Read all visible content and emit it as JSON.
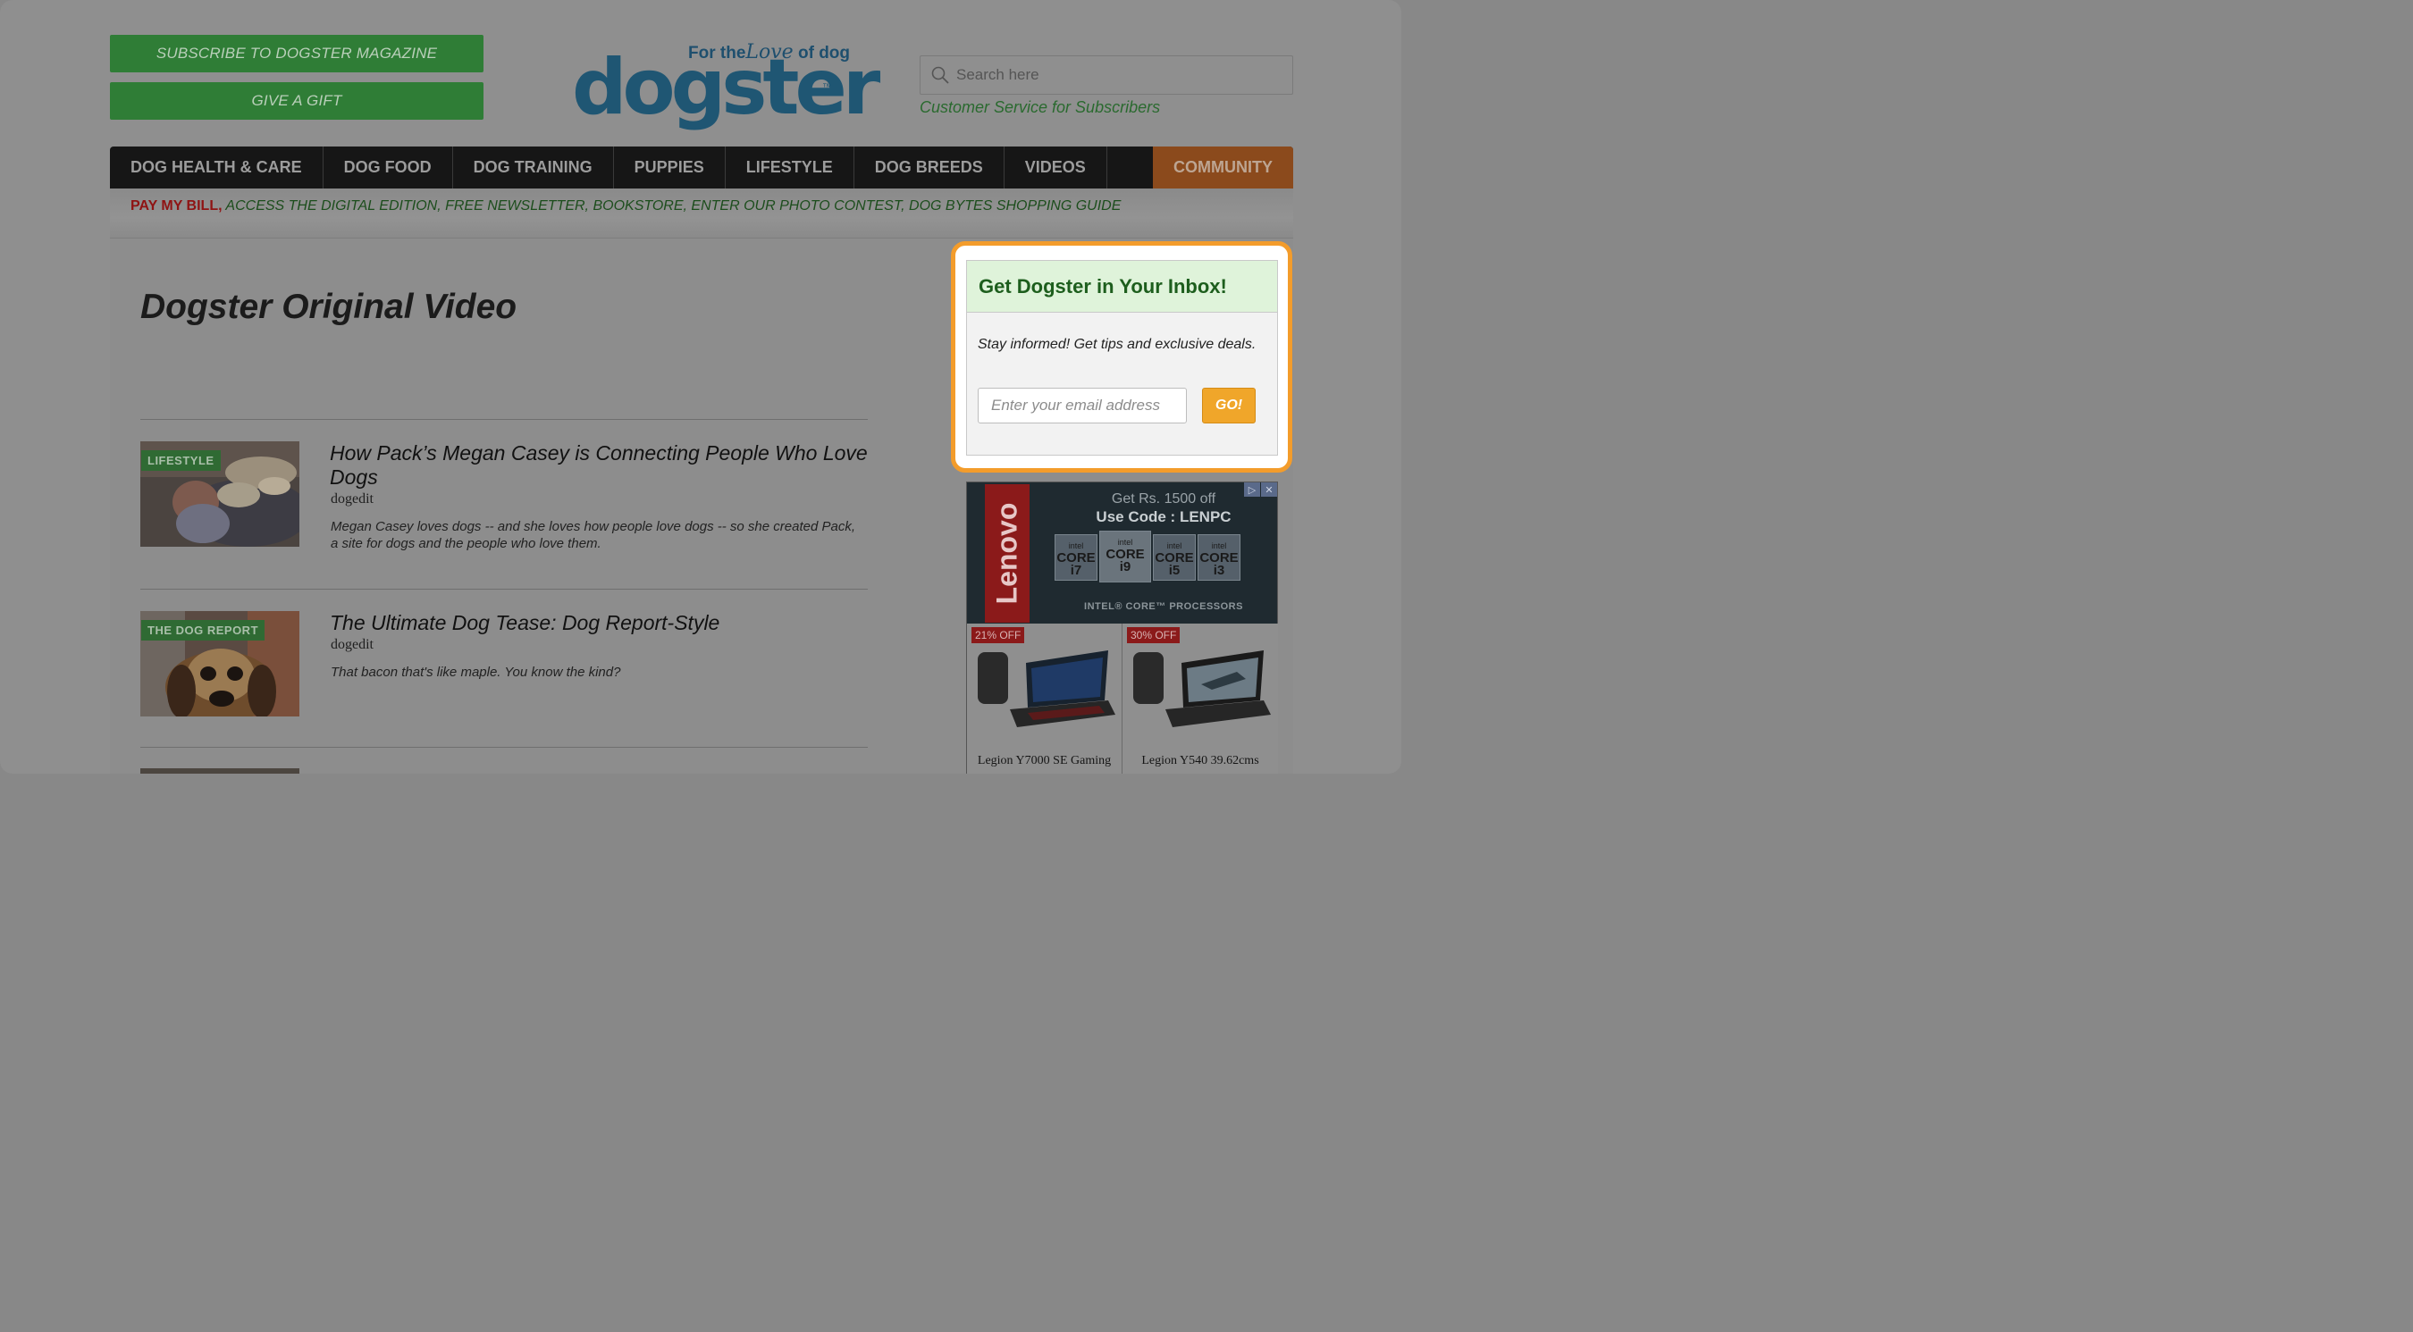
{
  "header": {
    "subscribe_label": "SUBSCRIBE TO DOGSTER MAGAZINE",
    "gift_label": "GIVE A GIFT",
    "logo": {
      "tagline_pre": "For the",
      "tagline_love": "Love",
      "tagline_post": "of dog",
      "wordmark": "dogster",
      "tm": "™"
    },
    "search_placeholder": "Search here",
    "customer_service": "Customer Service for Subscribers"
  },
  "nav": {
    "items": [
      {
        "label": "DOG HEALTH & CARE"
      },
      {
        "label": "DOG FOOD"
      },
      {
        "label": "DOG TRAINING"
      },
      {
        "label": "PUPPIES"
      },
      {
        "label": "LIFESTYLE"
      },
      {
        "label": "DOG BREEDS"
      },
      {
        "label": "VIDEOS"
      }
    ],
    "community": "COMMUNITY"
  },
  "subbar": {
    "pay": "PAY MY BILL,",
    "links": [
      "ACCESS THE DIGITAL EDITION,",
      "FREE NEWSLETTER,",
      "BOOKSTORE,",
      "ENTER OUR PHOTO CONTEST,",
      "DOG BYTES SHOPPING GUIDE"
    ]
  },
  "main": {
    "page_title": "Dogster Original Video",
    "articles": [
      {
        "tag": "LIFESTYLE",
        "title": "How Pack’s Megan Casey is Connecting People Who Love Dogs",
        "author": "dogedit",
        "description": "Megan Casey loves dogs -- and she loves how people love dogs -- so she created Pack, a site for dogs and the people who love them."
      },
      {
        "tag": "THE DOG REPORT",
        "title": "The Ultimate Dog Tease: Dog Report-Style",
        "author": "dogedit",
        "description": "That bacon that's like maple. You know the kind?"
      }
    ]
  },
  "newsletter": {
    "heading": "Get Dogster in Your Inbox!",
    "text": "Stay informed! Get tips and exclusive deals.",
    "email_placeholder": "Enter your email address",
    "go_label": "GO!"
  },
  "ad": {
    "brand": "Lenovo",
    "offer_line1": "Get Rs. 1500 off",
    "offer_line2": "Use Code : LENPC",
    "chips": [
      {
        "brand": "intel",
        "name": "CORE i7"
      },
      {
        "brand": "intel",
        "name": "CORE i9"
      },
      {
        "brand": "intel",
        "name": "CORE i5"
      },
      {
        "brand": "intel",
        "name": "CORE i3"
      }
    ],
    "processors": "INTEL® CORE™ PROCESSORS",
    "products": [
      {
        "discount": "21% OFF",
        "name": "Legion Y7000 SE Gaming"
      },
      {
        "discount": "30% OFF",
        "name": "Legion Y540 39.62cms"
      }
    ]
  },
  "colors": {
    "green_button": "#2f7d36",
    "nav_bg": "#161616",
    "community_bg": "#8b4a1c",
    "highlight_orange": "#f39c2b",
    "go_orange": "#f0a62a",
    "logo_blue": "#1f5673"
  }
}
